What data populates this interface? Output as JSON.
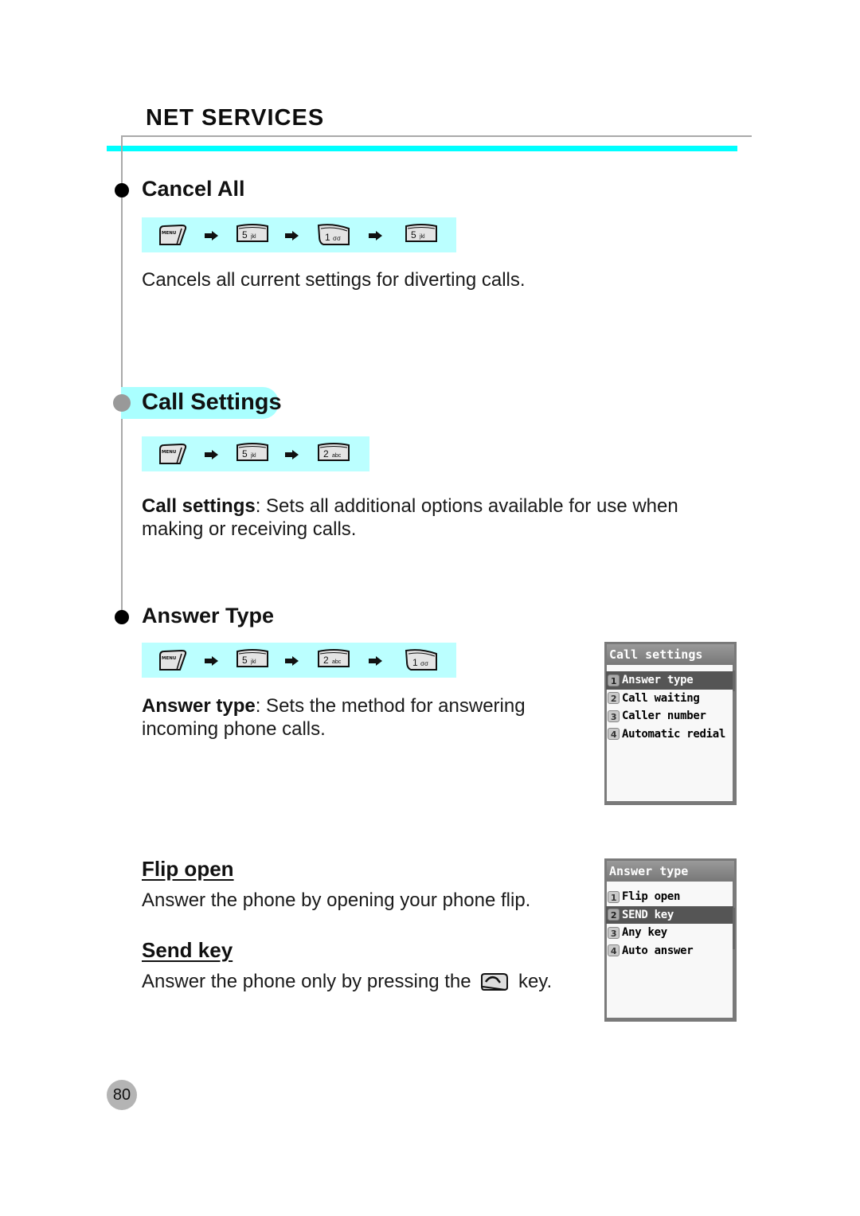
{
  "header": {
    "title": "NET SERVICES",
    "accent_color": "#00ffff"
  },
  "sections": {
    "cancel_all": {
      "heading": "Cancel All",
      "key_sequence": [
        {
          "type": "menu-key",
          "label": "MENU"
        },
        {
          "type": "number-key",
          "digit": "5",
          "letters": "jkl"
        },
        {
          "type": "number-key-curved",
          "digit": "1",
          "letters": "σσ"
        },
        {
          "type": "number-key",
          "digit": "5",
          "letters": "jkl"
        }
      ],
      "description": "Cancels all current settings for diverting calls."
    },
    "call_settings": {
      "heading": "Call Settings",
      "key_sequence": [
        {
          "type": "menu-key",
          "label": "MENU"
        },
        {
          "type": "number-key",
          "digit": "5",
          "letters": "jkl"
        },
        {
          "type": "number-key",
          "digit": "2",
          "letters": "abc"
        }
      ],
      "description_bold": "Call settings",
      "description_rest": ": Sets all additional options available for use when",
      "description_line2": "making or receiving calls."
    },
    "answer_type": {
      "heading": "Answer Type",
      "key_sequence": [
        {
          "type": "menu-key",
          "label": "MENU"
        },
        {
          "type": "number-key",
          "digit": "5",
          "letters": "jkl"
        },
        {
          "type": "number-key",
          "digit": "2",
          "letters": "abc"
        },
        {
          "type": "number-key-curved",
          "digit": "1",
          "letters": "σσ"
        }
      ],
      "description_bold": "Answer type",
      "description_rest": ": Sets the method for answering",
      "description_line2": "incoming phone calls.",
      "flip_open": {
        "heading": "Flip open",
        "description": "Answer the phone by opening your phone flip."
      },
      "send_key": {
        "heading": "Send key",
        "description_before": "Answer the phone only by pressing the",
        "icon": "send-key-icon",
        "description_after": "key."
      }
    }
  },
  "screens": {
    "call_settings_screen": {
      "title": "Call settings",
      "items": [
        {
          "num": "1",
          "label": "Answer type",
          "selected": true
        },
        {
          "num": "2",
          "label": "Call waiting",
          "selected": false
        },
        {
          "num": "3",
          "label": "Caller number",
          "selected": false
        },
        {
          "num": "4",
          "label": "Automatic redial",
          "selected": false
        }
      ]
    },
    "answer_type_screen": {
      "title": "Answer type",
      "items": [
        {
          "num": "1",
          "label": "Flip open",
          "selected": false
        },
        {
          "num": "2",
          "label": "SEND key",
          "selected": true
        },
        {
          "num": "3",
          "label": "Any key",
          "selected": false
        },
        {
          "num": "4",
          "label": "Auto answer",
          "selected": false
        }
      ]
    }
  },
  "footer": {
    "page_number": "80"
  }
}
